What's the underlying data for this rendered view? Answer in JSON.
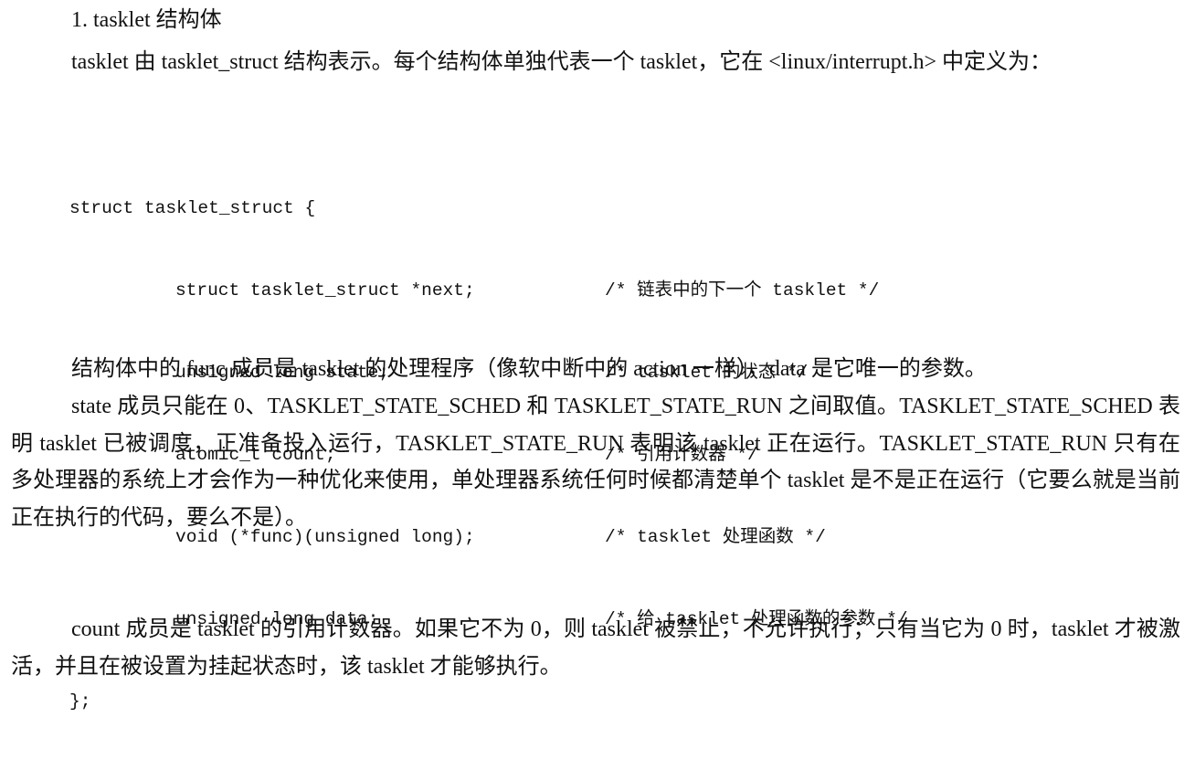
{
  "heading": "1. tasklet 结构体",
  "paragraphs": {
    "intro": "tasklet 由 tasklet_struct 结构表示。每个结构体单独代表一个 tasklet，它在 <linux/interrupt.h> 中定义为：",
    "func_data": "结构体中的 func 成员是 tasklet 的处理程序（像软中断中的 action 一样），data 是它唯一的参数。",
    "state": "state 成员只能在 0、TASKLET_STATE_SCHED 和 TASKLET_STATE_RUN 之间取值。TASKLET_STATE_SCHED 表明 tasklet 已被调度，正准备投入运行，TASKLET_STATE_RUN 表明该 tasklet 正在运行。TASKLET_STATE_RUN 只有在多处理器的系统上才会作为一种优化来使用，单处理器系统任何时候都清楚单个 tasklet 是不是正在运行（它要么就是当前正在执行的代码，要么不是）。",
    "count": "count 成员是 tasklet 的引用计数器。如果它不为 0，则 tasklet 被禁止，不允许执行；只有当它为 0 时，tasklet 才被激活，并且在被设置为挂起状态时，该 tasklet 才能够执行。"
  },
  "code": {
    "open": "struct tasklet_struct {",
    "fields": [
      {
        "text": "struct tasklet_struct *next;",
        "comment": "/* 链表中的下一个 tasklet */"
      },
      {
        "text": "unsigned long state;",
        "comment": "/* tasklet 的状态 */"
      },
      {
        "text": "atomic_t count;",
        "comment": "/* 引用计数器 */"
      },
      {
        "text": "void (*func)(unsigned long);",
        "comment": "/* tasklet 处理函数 */"
      },
      {
        "text": "unsigned long data;",
        "comment": "/* 给 tasklet 处理函数的参数 */"
      }
    ],
    "close": "};"
  }
}
